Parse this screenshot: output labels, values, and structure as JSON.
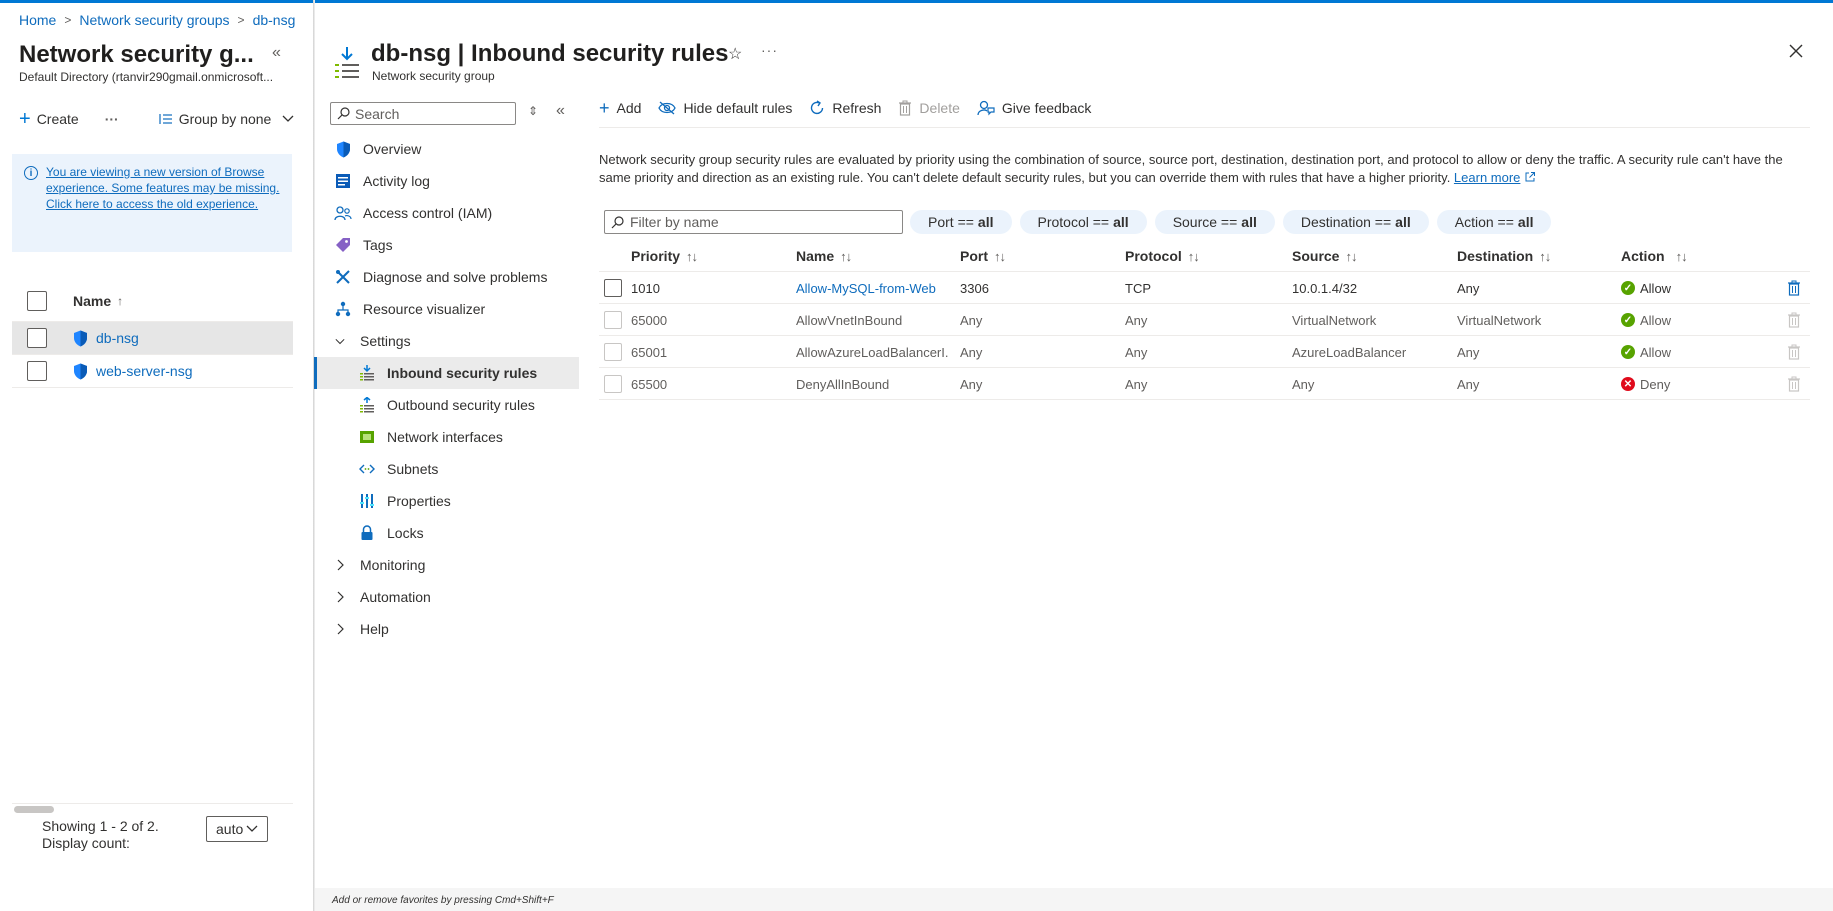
{
  "breadcrumb": {
    "items": [
      "Home",
      "Network security groups",
      "db-nsg"
    ],
    "separator": ">"
  },
  "left_blade": {
    "title": "Network security g...",
    "subtitle": "Default Directory (rtanvir290gmail.onmicrosoft...",
    "toolbar": {
      "create_label": "Create",
      "more_label": "···",
      "group_by_label": "Group by none"
    },
    "info_banner": {
      "text": "You are viewing a new version of Browse experience. Some features may be missing. Click here to access the old experience."
    },
    "table": {
      "header_name": "Name",
      "sort_indicator": "↑",
      "rows": [
        {
          "name": "db-nsg",
          "selected": true
        },
        {
          "name": "web-server-nsg",
          "selected": false
        }
      ]
    },
    "footer": {
      "showing_text": "Showing 1 - 2 of 2. Display count:",
      "display_count_value": "auto"
    }
  },
  "resource": {
    "name": "db-nsg",
    "separator": " | ",
    "page": "Inbound security rules",
    "type_label": "Network security group"
  },
  "menu": {
    "search_placeholder": "Search",
    "items": [
      {
        "label": "Overview",
        "icon": "shield-icon",
        "kind": "item"
      },
      {
        "label": "Activity log",
        "icon": "activity-log-icon",
        "kind": "item"
      },
      {
        "label": "Access control (IAM)",
        "icon": "people-icon",
        "kind": "item"
      },
      {
        "label": "Tags",
        "icon": "tag-icon",
        "kind": "item"
      },
      {
        "label": "Diagnose and solve problems",
        "icon": "wrench-icon",
        "kind": "item"
      },
      {
        "label": "Resource visualizer",
        "icon": "hierarchy-icon",
        "kind": "item"
      },
      {
        "label": "Settings",
        "icon": "chevron-down-icon",
        "kind": "group",
        "expanded": true
      },
      {
        "label": "Inbound security rules",
        "icon": "inbound-icon",
        "kind": "sub",
        "active": true
      },
      {
        "label": "Outbound security rules",
        "icon": "outbound-icon",
        "kind": "sub"
      },
      {
        "label": "Network interfaces",
        "icon": "nic-icon",
        "kind": "sub"
      },
      {
        "label": "Subnets",
        "icon": "subnet-icon",
        "kind": "sub"
      },
      {
        "label": "Properties",
        "icon": "properties-icon",
        "kind": "sub"
      },
      {
        "label": "Locks",
        "icon": "lock-icon",
        "kind": "sub"
      },
      {
        "label": "Monitoring",
        "icon": "chevron-right-icon",
        "kind": "group",
        "expanded": false
      },
      {
        "label": "Automation",
        "icon": "chevron-right-icon",
        "kind": "group",
        "expanded": false
      },
      {
        "label": "Help",
        "icon": "chevron-right-icon",
        "kind": "group",
        "expanded": false
      }
    ]
  },
  "command_bar": {
    "add": "Add",
    "hide_default": "Hide default rules",
    "refresh": "Refresh",
    "delete": "Delete",
    "feedback": "Give feedback"
  },
  "description": {
    "text": "Network security group security rules are evaluated by priority using the combination of source, source port, destination, destination port, and protocol to allow or deny the traffic. A security rule can't have the same priority and direction as an existing rule. You can't delete default security rules, but you can override them with rules that have a higher priority. ",
    "learn_more": "Learn more"
  },
  "filters": {
    "placeholder": "Filter by name",
    "pills": [
      {
        "key": "Port ==",
        "value": "all"
      },
      {
        "key": "Protocol ==",
        "value": "all"
      },
      {
        "key": "Source ==",
        "value": "all"
      },
      {
        "key": "Destination ==",
        "value": "all"
      },
      {
        "key": "Action ==",
        "value": "all"
      }
    ]
  },
  "rules_table": {
    "headers": {
      "priority": "Priority",
      "name": "Name",
      "port": "Port",
      "protocol": "Protocol",
      "source": "Source",
      "destination": "Destination",
      "action": "Action"
    },
    "sort_icon": "↑↓",
    "rows": [
      {
        "priority": "1010",
        "name": "Allow-MySQL-from-Web",
        "port": "3306",
        "protocol": "TCP",
        "source": "10.0.1.4/32",
        "destination": "Any",
        "action": "Allow",
        "default": false
      },
      {
        "priority": "65000",
        "name": "AllowVnetInBound",
        "port": "Any",
        "protocol": "Any",
        "source": "VirtualNetwork",
        "destination": "VirtualNetwork",
        "action": "Allow",
        "default": true
      },
      {
        "priority": "65001",
        "name": "AllowAzureLoadBalancerI...",
        "port": "Any",
        "protocol": "Any",
        "source": "AzureLoadBalancer",
        "destination": "Any",
        "action": "Allow",
        "default": true
      },
      {
        "priority": "65500",
        "name": "DenyAllInBound",
        "port": "Any",
        "protocol": "Any",
        "source": "Any",
        "destination": "Any",
        "action": "Deny",
        "default": true
      }
    ]
  },
  "footer_hint": "Add or remove favorites by pressing Cmd+Shift+F",
  "colors": {
    "accent": "#0f6cbd",
    "allow": "#57a300",
    "deny": "#e00b1c"
  }
}
